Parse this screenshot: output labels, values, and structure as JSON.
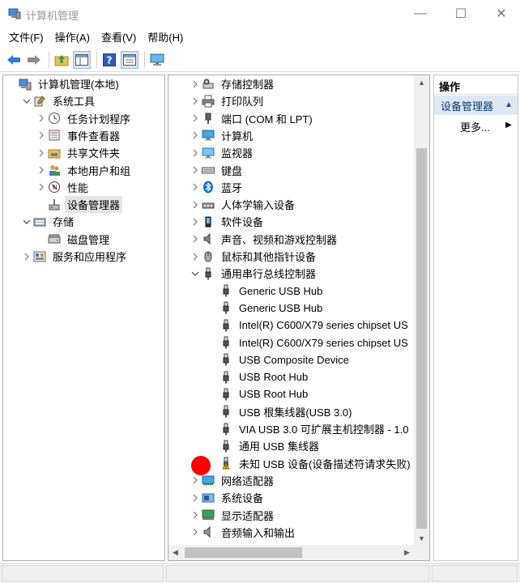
{
  "window": {
    "title": "计算机管理",
    "controls": {
      "minimize": "—",
      "maximize": "☐",
      "close": "✕"
    }
  },
  "menu": [
    "文件(F)",
    "操作(A)",
    "查看(V)",
    "帮助(H)"
  ],
  "toolbar": [
    "back-icon",
    "forward-icon",
    "up-folder-icon",
    "show-tree-icon",
    "help-icon",
    "properties-icon",
    "monitor-icon"
  ],
  "left_tree": [
    {
      "label": "计算机管理(本地)",
      "icon": "computer-management-icon",
      "expand": "",
      "indent": 0
    },
    {
      "label": "系统工具",
      "icon": "system-tools-icon",
      "expand": "open",
      "indent": 1
    },
    {
      "label": "任务计划程序",
      "icon": "task-scheduler-icon",
      "expand": "closed",
      "indent": 2
    },
    {
      "label": "事件查看器",
      "icon": "event-viewer-icon",
      "expand": "closed",
      "indent": 2
    },
    {
      "label": "共享文件夹",
      "icon": "shared-folder-icon",
      "expand": "closed",
      "indent": 2
    },
    {
      "label": "本地用户和组",
      "icon": "local-users-icon",
      "expand": "closed",
      "indent": 2
    },
    {
      "label": "性能",
      "icon": "performance-icon",
      "expand": "closed",
      "indent": 2
    },
    {
      "label": "设备管理器",
      "icon": "device-manager-icon",
      "expand": "",
      "indent": 2,
      "selected": true
    },
    {
      "label": "存储",
      "icon": "storage-icon",
      "expand": "open",
      "indent": 1
    },
    {
      "label": "磁盘管理",
      "icon": "disk-management-icon",
      "expand": "",
      "indent": 2
    },
    {
      "label": "服务和应用程序",
      "icon": "services-apps-icon",
      "expand": "closed",
      "indent": 1
    }
  ],
  "device_tree": [
    {
      "label": "存储控制器",
      "icon": "storage-controller-icon",
      "expand": "closed",
      "indent": 0
    },
    {
      "label": "打印队列",
      "icon": "printer-icon",
      "expand": "closed",
      "indent": 0
    },
    {
      "label": "端口 (COM 和 LPT)",
      "icon": "port-icon",
      "expand": "closed",
      "indent": 0
    },
    {
      "label": "计算机",
      "icon": "computer-icon",
      "expand": "closed",
      "indent": 0
    },
    {
      "label": "监视器",
      "icon": "monitor-icon",
      "expand": "closed",
      "indent": 0
    },
    {
      "label": "键盘",
      "icon": "keyboard-icon",
      "expand": "closed",
      "indent": 0
    },
    {
      "label": "蓝牙",
      "icon": "bluetooth-icon",
      "expand": "closed",
      "indent": 0
    },
    {
      "label": "人体学输入设备",
      "icon": "hid-icon",
      "expand": "closed",
      "indent": 0
    },
    {
      "label": "软件设备",
      "icon": "software-device-icon",
      "expand": "closed",
      "indent": 0
    },
    {
      "label": "声音、视频和游戏控制器",
      "icon": "sound-icon",
      "expand": "closed",
      "indent": 0
    },
    {
      "label": "鼠标和其他指针设备",
      "icon": "mouse-icon",
      "expand": "closed",
      "indent": 0
    },
    {
      "label": "通用串行总线控制器",
      "icon": "usb-icon",
      "expand": "open",
      "indent": 0
    },
    {
      "label": "Generic USB Hub",
      "icon": "usb-icon",
      "expand": "",
      "indent": 1
    },
    {
      "label": "Generic USB Hub",
      "icon": "usb-icon",
      "expand": "",
      "indent": 1
    },
    {
      "label": "Intel(R) C600/X79 series chipset US",
      "icon": "usb-icon",
      "expand": "",
      "indent": 1
    },
    {
      "label": "Intel(R) C600/X79 series chipset US",
      "icon": "usb-icon",
      "expand": "",
      "indent": 1
    },
    {
      "label": "USB Composite Device",
      "icon": "usb-icon",
      "expand": "",
      "indent": 1
    },
    {
      "label": "USB Root Hub",
      "icon": "usb-icon",
      "expand": "",
      "indent": 1
    },
    {
      "label": "USB Root Hub",
      "icon": "usb-icon",
      "expand": "",
      "indent": 1
    },
    {
      "label": "USB 根集线器(USB 3.0)",
      "icon": "usb-icon",
      "expand": "",
      "indent": 1
    },
    {
      "label": "VIA USB 3.0 可扩展主机控制器 - 1.0",
      "icon": "usb-icon",
      "expand": "",
      "indent": 1
    },
    {
      "label": "通用 USB 集线器",
      "icon": "usb-icon",
      "expand": "",
      "indent": 1
    },
    {
      "label": "未知 USB 设备(设备描述符请求失败)",
      "icon": "warning-icon",
      "expand": "",
      "indent": 1
    },
    {
      "label": "网络适配器",
      "icon": "network-adapter-icon",
      "expand": "closed",
      "indent": 0
    },
    {
      "label": "系统设备",
      "icon": "system-device-icon",
      "expand": "closed",
      "indent": 0
    },
    {
      "label": "显示适配器",
      "icon": "display-adapter-icon",
      "expand": "closed",
      "indent": 0
    },
    {
      "label": "音频输入和输出",
      "icon": "audio-icon",
      "expand": "closed",
      "indent": 0
    }
  ],
  "actions": {
    "header": "操作",
    "section": "设备管理器",
    "more": "更多..."
  },
  "colors": {
    "red_marker": "#ff0000",
    "selection": "#e5e5e5",
    "actions_section": "#dce9f5"
  }
}
